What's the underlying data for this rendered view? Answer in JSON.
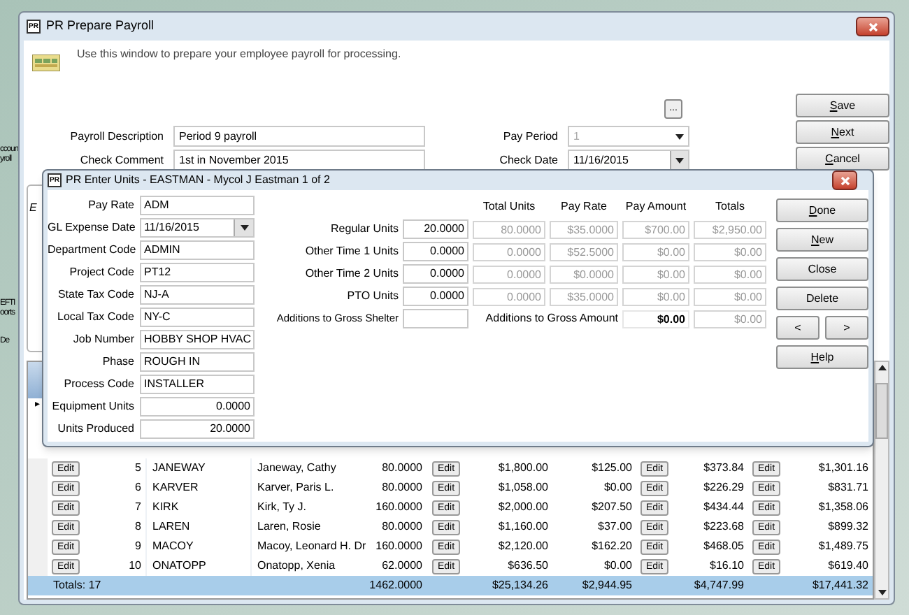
{
  "desktop_icons": [
    {
      "lines": [
        "ccoun",
        "yroll"
      ]
    },
    {
      "lines": [
        "EFTI",
        "oorts"
      ]
    },
    {
      "lines": [
        "De"
      ]
    }
  ],
  "main_window": {
    "title": "PR Prepare Payroll",
    "icon_text": "PR",
    "description": "Use this window to prepare your employee payroll for processing.",
    "ellipsis_button": "...",
    "fields": [
      {
        "label": "Payroll Description",
        "value": "Period 9 payroll"
      },
      {
        "label": "Check Comment",
        "value": "1st in November 2015"
      }
    ],
    "side_fields": [
      {
        "label": "Pay Period",
        "value": "1",
        "disabled": true,
        "kind": "combo"
      },
      {
        "label": "Check Date",
        "value": "11/16/2015",
        "disabled": false,
        "kind": "dropdown"
      }
    ],
    "buttons": [
      {
        "label": "Save",
        "underline_first": true
      },
      {
        "label": "Next",
        "underline_first": true
      },
      {
        "label": "Cancel",
        "underline_first": true
      }
    ],
    "group_legend": "E",
    "grid": {
      "current_row_marker": "▸",
      "rows": [
        {
          "cells": [
            {
              "kind": "button",
              "text": "Edit"
            },
            {
              "kind": "number",
              "text": "5"
            },
            {
              "kind": "text",
              "text": "JANEWAY"
            },
            {
              "kind": "text",
              "text": "Janeway, Cathy"
            },
            {
              "kind": "number",
              "text": "80.0000"
            },
            {
              "kind": "button",
              "text": "Edit"
            },
            {
              "kind": "number",
              "text": "$1,800.00"
            },
            {
              "kind": "number",
              "text": "$125.00"
            },
            {
              "kind": "button",
              "text": "Edit"
            },
            {
              "kind": "number",
              "text": "$373.84"
            },
            {
              "kind": "button",
              "text": "Edit"
            },
            {
              "kind": "number",
              "text": "$1,301.16"
            }
          ]
        },
        {
          "cells": [
            {
              "kind": "button",
              "text": "Edit"
            },
            {
              "kind": "number",
              "text": "6"
            },
            {
              "kind": "text",
              "text": "KARVER"
            },
            {
              "kind": "text",
              "text": "Karver, Paris L."
            },
            {
              "kind": "number",
              "text": "80.0000"
            },
            {
              "kind": "button",
              "text": "Edit"
            },
            {
              "kind": "number",
              "text": "$1,058.00"
            },
            {
              "kind": "number",
              "text": "$0.00"
            },
            {
              "kind": "button",
              "text": "Edit"
            },
            {
              "kind": "number",
              "text": "$226.29"
            },
            {
              "kind": "button",
              "text": "Edit"
            },
            {
              "kind": "number",
              "text": "$831.71"
            }
          ]
        },
        {
          "cells": [
            {
              "kind": "button",
              "text": "Edit"
            },
            {
              "kind": "number",
              "text": "7"
            },
            {
              "kind": "text",
              "text": "KIRK"
            },
            {
              "kind": "text",
              "text": "Kirk, Ty J."
            },
            {
              "kind": "number",
              "text": "160.0000"
            },
            {
              "kind": "button",
              "text": "Edit"
            },
            {
              "kind": "number",
              "text": "$2,000.00"
            },
            {
              "kind": "number",
              "text": "$207.50"
            },
            {
              "kind": "button",
              "text": "Edit"
            },
            {
              "kind": "number",
              "text": "$434.44"
            },
            {
              "kind": "button",
              "text": "Edit"
            },
            {
              "kind": "number",
              "text": "$1,358.06"
            }
          ]
        },
        {
          "cells": [
            {
              "kind": "button",
              "text": "Edit"
            },
            {
              "kind": "number",
              "text": "8"
            },
            {
              "kind": "text",
              "text": "LAREN"
            },
            {
              "kind": "text",
              "text": "Laren, Rosie"
            },
            {
              "kind": "number",
              "text": "80.0000"
            },
            {
              "kind": "button",
              "text": "Edit"
            },
            {
              "kind": "number",
              "text": "$1,160.00"
            },
            {
              "kind": "number",
              "text": "$37.00"
            },
            {
              "kind": "button",
              "text": "Edit"
            },
            {
              "kind": "number",
              "text": "$223.68"
            },
            {
              "kind": "button",
              "text": "Edit"
            },
            {
              "kind": "number",
              "text": "$899.32"
            }
          ]
        },
        {
          "cells": [
            {
              "kind": "button",
              "text": "Edit"
            },
            {
              "kind": "number",
              "text": "9"
            },
            {
              "kind": "text",
              "text": "MACOY"
            },
            {
              "kind": "text",
              "text": "Macoy, Leonard H. Dr"
            },
            {
              "kind": "number",
              "text": "160.0000"
            },
            {
              "kind": "button",
              "text": "Edit"
            },
            {
              "kind": "number",
              "text": "$2,120.00"
            },
            {
              "kind": "number",
              "text": "$162.20"
            },
            {
              "kind": "button",
              "text": "Edit"
            },
            {
              "kind": "number",
              "text": "$468.05"
            },
            {
              "kind": "button",
              "text": "Edit"
            },
            {
              "kind": "number",
              "text": "$1,489.75"
            }
          ]
        },
        {
          "cells": [
            {
              "kind": "button",
              "text": "Edit"
            },
            {
              "kind": "number",
              "text": "10"
            },
            {
              "kind": "text",
              "text": "ONATOPP"
            },
            {
              "kind": "text",
              "text": "Onatopp, Xenia"
            },
            {
              "kind": "number",
              "text": "62.0000"
            },
            {
              "kind": "button",
              "text": "Edit"
            },
            {
              "kind": "number",
              "text": "$636.50"
            },
            {
              "kind": "number",
              "text": "$0.00"
            },
            {
              "kind": "button",
              "text": "Edit"
            },
            {
              "kind": "number",
              "text": "$16.10"
            },
            {
              "kind": "button",
              "text": "Edit"
            },
            {
              "kind": "number",
              "text": "$619.40"
            }
          ]
        }
      ],
      "totals": {
        "label": "Totals: 17",
        "values": [
          "1462.0000",
          "$25,134.26",
          "$2,944.95",
          "$4,747.99",
          "$17,441.32"
        ]
      }
    }
  },
  "dialog": {
    "title": "PR Enter Units - EASTMAN - Mycol J Eastman 1 of 2",
    "icon_text": "PR",
    "left_fields": [
      {
        "label": "Pay Rate",
        "value": "ADM",
        "kind": "text"
      },
      {
        "label": "GL Expense Date",
        "value": "11/16/2015",
        "kind": "dropdown"
      },
      {
        "label": "Department Code",
        "value": "ADMIN",
        "kind": "text"
      },
      {
        "label": "Project Code",
        "value": "PT12",
        "kind": "text"
      },
      {
        "label": "State Tax Code",
        "value": "NJ-A",
        "kind": "text"
      },
      {
        "label": "Local Tax Code",
        "value": "NY-C",
        "kind": "text"
      },
      {
        "label": "Job Number",
        "value": "HOBBY SHOP HVAC",
        "kind": "text"
      },
      {
        "label": "Phase",
        "value": "ROUGH IN",
        "kind": "text"
      },
      {
        "label": "Process Code",
        "value": "INSTALLER",
        "kind": "text"
      },
      {
        "label": "Equipment Units",
        "value": "0.0000",
        "kind": "number"
      },
      {
        "label": "Units Produced",
        "value": "20.0000",
        "kind": "number"
      }
    ],
    "columns": [
      "Total Units",
      "Pay Rate",
      "Pay Amount",
      "Totals"
    ],
    "unit_rows": [
      {
        "label": "Regular Units",
        "units": "20.0000",
        "values": [
          "80.0000",
          "$35.0000",
          "$700.00",
          "$2,950.00"
        ]
      },
      {
        "label": "Other Time 1 Units",
        "units": "0.0000",
        "values": [
          "0.0000",
          "$52.5000",
          "$0.00",
          "$0.00"
        ]
      },
      {
        "label": "Other Time 2 Units",
        "units": "0.0000",
        "values": [
          "0.0000",
          "$0.0000",
          "$0.00",
          "$0.00"
        ]
      },
      {
        "label": "PTO Units",
        "units": "0.0000",
        "values": [
          "0.0000",
          "$35.0000",
          "$0.00",
          "$0.00"
        ]
      }
    ],
    "gross_shelter": {
      "label": "Additions to Gross Shelter"
    },
    "gross_amount": {
      "label": "Additions to Gross Amount",
      "amount": "$0.00",
      "total": "$0.00"
    },
    "buttons": [
      {
        "label": "Done",
        "underline_first": true,
        "kind": "wide"
      },
      {
        "label": "New",
        "underline_first": true,
        "kind": "wide"
      },
      {
        "label": "Close",
        "underline_first": false,
        "kind": "wide"
      },
      {
        "label": "Delete",
        "underline_first": false,
        "kind": "wide"
      },
      {
        "label": "<",
        "underline_first": false,
        "kind": "half"
      },
      {
        "label": ">",
        "underline_first": false,
        "kind": "half"
      },
      {
        "label": "Help",
        "underline_first": true,
        "kind": "wide"
      }
    ]
  }
}
